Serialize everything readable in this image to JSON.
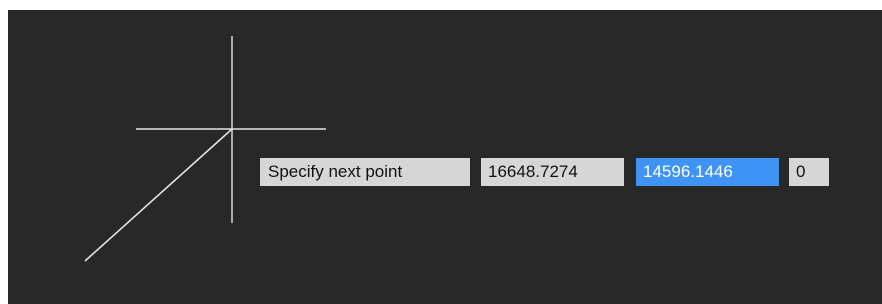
{
  "viewport": {
    "background_color": "#282828",
    "geometry_color": "#e4e4e4"
  },
  "dynamic_input": {
    "prompt": "Specify next point",
    "x_value": "16648.7274",
    "y_value": "14596.1446",
    "z_value": "0",
    "active_field": "y",
    "active_color": "#3e93f5"
  },
  "icons": {
    "crosshair": "crosshair-cursor-icon"
  }
}
